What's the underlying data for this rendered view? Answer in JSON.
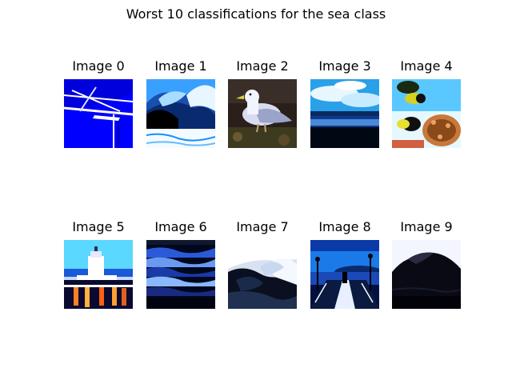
{
  "figure": {
    "title": "Worst 10 classifications for the sea class"
  },
  "panels": [
    {
      "title": "Image 0",
      "scene": "blue-grid"
    },
    {
      "title": "Image 1",
      "scene": "breaking-wave"
    },
    {
      "title": "Image 2",
      "scene": "seagull"
    },
    {
      "title": "Image 3",
      "scene": "sky-lake"
    },
    {
      "title": "Image 4",
      "scene": "reef-fish"
    },
    {
      "title": "Image 5",
      "scene": "lighthouse"
    },
    {
      "title": "Image 6",
      "scene": "night-waves"
    },
    {
      "title": "Image 7",
      "scene": "wave-spray"
    },
    {
      "title": "Image 8",
      "scene": "pier"
    },
    {
      "title": "Image 9",
      "scene": "dark-hill"
    }
  ]
}
